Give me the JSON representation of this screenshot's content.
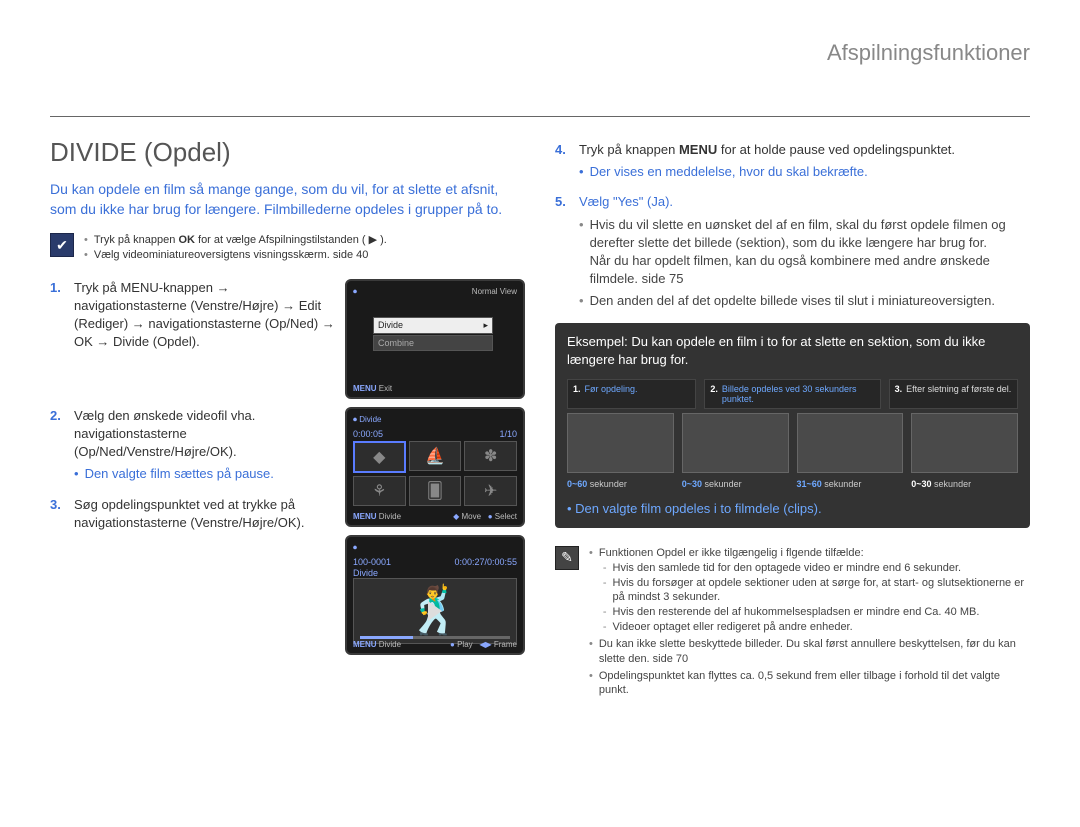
{
  "header": {
    "section": "Afspilningsfunktioner"
  },
  "title": "DIVIDE (Opdel)",
  "intro": "Du kan opdele en film så mange gange, som du vil, for at slette et afsnit, som du ikke har brug for længere.\nFilmbillederne opdeles i grupper på to.",
  "info": {
    "line1_pre": "Tryk på knappen ",
    "line1_mid": "OK",
    "line1_post": " for at vælge Afspilningstilstanden ( ▶ ).",
    "line2": "Vælg videominiatureoversigtens visningsskærm.  side 40"
  },
  "lcd1": {
    "title_right": "Normal View",
    "menu_divide": "Divide",
    "menu_combine": "Combine",
    "menu_exit_l": "MENU",
    "menu_exit_r": "Exit"
  },
  "lcd2": {
    "title_left": "Divide",
    "time": "0:00:05",
    "counter": "1/10",
    "bot_menu": "MENU",
    "bot_divide": "Divide",
    "bot_move": "Move",
    "bot_select": "Select"
  },
  "lcd3": {
    "line1_left": "100-0001",
    "line1_right": "0:00:27/0:00:55",
    "label": "Divide",
    "bot_menu": "MENU",
    "bot_divide": "Divide",
    "bot_play": "Play",
    "bot_frame": "Frame"
  },
  "steps_left": [
    {
      "num": "1.",
      "body": "Tryk på MENU-knappen → navigationstasterne (Venstre/Højre) → Edit (Rediger) → navigationstasterne (Op/Ned) → OK → Divide (Opdel)."
    },
    {
      "num": "2.",
      "body": "Vælg den ønskede videofil vha. navigationstasterne (Op/Ned/Venstre/Højre/OK).",
      "sub": "Den valgte film sættes på pause."
    },
    {
      "num": "3.",
      "body": "Søg opdelingspunktet ved at trykke på navigationstasterne (Venstre/Højre/OK)."
    }
  ],
  "steps_right": [
    {
      "num": "4.",
      "body_pre": "Tryk på knappen ",
      "body_mid": "MENU",
      "body_post": " for at holde pause ved opdelingspunktet.",
      "sub": "Der vises en meddelelse, hvor du skal bekræfte."
    },
    {
      "num": "5.",
      "body": "Vælg \"Yes\" (Ja).",
      "subs": [
        "Hvis du vil slette en uønsket del af en film, skal du først opdele filmen og derefter slette det billede (sektion), som du ikke længere har brug for.\nNår du har opdelt filmen, kan du også kombinere med andre ønskede filmdele.  side 75",
        "Den anden del af det opdelte billede vises til slut i miniatureoversigten."
      ]
    }
  ],
  "example": {
    "lead": "Eksempel:",
    "text": "Du kan opdele en film i to for at slette en sektion, som du ikke længere har brug for.",
    "labels": [
      {
        "n": "1.",
        "t": "Før opdeling."
      },
      {
        "n": "2.",
        "t": "Billede opdeles ved 30 sekunders punktet."
      },
      {
        "n": "3.",
        "t": "Efter sletning af første del."
      }
    ],
    "times": [
      {
        "range": "0~60",
        "unit": "sekunder"
      },
      {
        "range": "0~30",
        "unit": "sekunder"
      },
      {
        "range": "31~60",
        "unit": "sekunder"
      },
      {
        "range": "0~30",
        "unit": "sekunder"
      }
    ],
    "caption": "Den valgte film opdeles i to filmdele (clips)."
  },
  "footer": {
    "intro": "Funktionen Opdel er ikke tilgængelig i flgende tilfælde:",
    "dashes": [
      "Hvis den samlede tid for den optagede video er mindre end 6 sekunder.",
      "Hvis du forsøger at opdele sektioner uden at sørge for, at start- og slutsektionerne er på mindst 3 sekunder.",
      "Hvis den resterende del af hukommelsespladsen er mindre end Ca. 40 MB.",
      "Videoer optaget eller redigeret på andre enheder."
    ],
    "bullets": [
      "Du kan ikke slette beskyttede billeder. Du skal først annullere beskyttelsen, før du kan slette den.  side 70",
      "Opdelingspunktet kan flyttes ca. 0,5 sekund frem eller tilbage i forhold til det valgte punkt."
    ]
  }
}
